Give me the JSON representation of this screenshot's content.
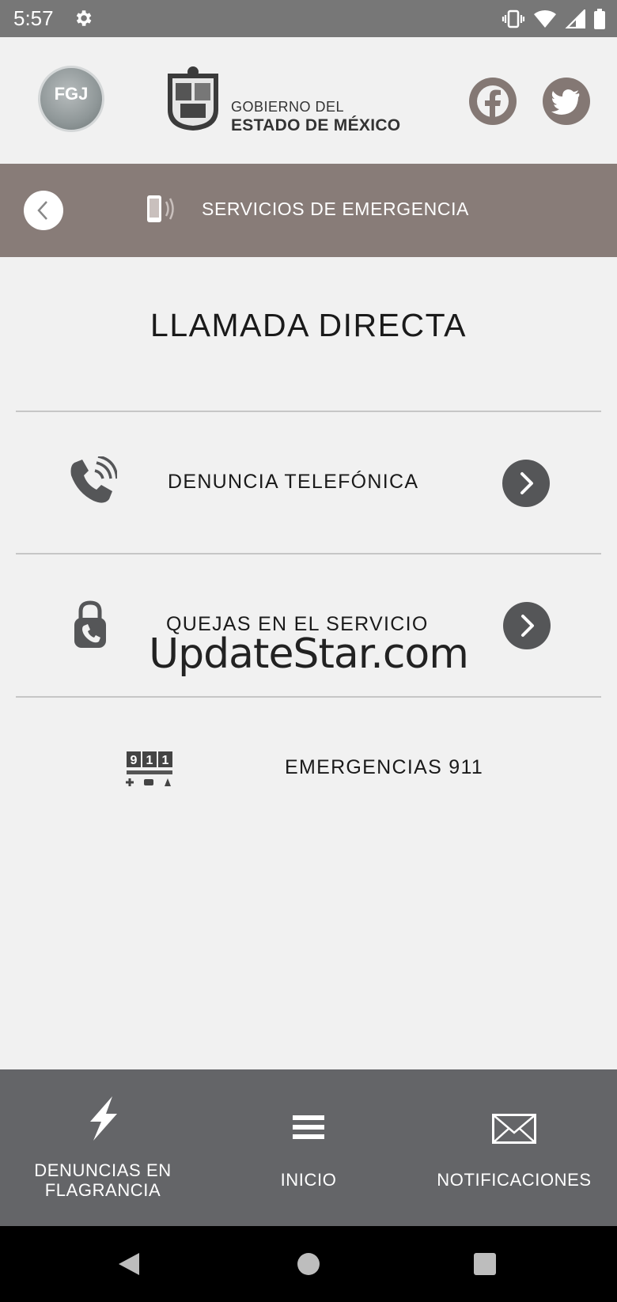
{
  "status_bar": {
    "time": "5:57",
    "icons": [
      "settings-gear-icon",
      "vibrate-icon",
      "wifi-icon",
      "signal-icon",
      "battery-icon"
    ]
  },
  "header": {
    "fgj_logo_text": "FGJ",
    "gov_line1": "GOBIERNO DEL",
    "gov_line2": "ESTADO DE MÉXICO",
    "social": [
      "facebook-icon",
      "twitter-icon"
    ]
  },
  "band": {
    "title": "SERVICIOS DE EMERGENCIA",
    "color": "#887c78"
  },
  "main": {
    "heading": "LLAMADA DIRECTA",
    "items": [
      {
        "label": "DENUNCIA TELEFÓNICA",
        "icon": "phone-call-icon"
      },
      {
        "label": "QUEJAS EN EL SERVICIO",
        "icon": "lock-phone-icon"
      },
      {
        "label": "EMERGENCIAS 911",
        "icon": "emergencias-911-icon"
      }
    ],
    "watermark": "UpdateStar.com"
  },
  "bottom_nav": {
    "tabs": [
      {
        "label_line1": "DENUNCIAS EN",
        "label_line2": "FLAGRANCIA",
        "icon": "lightning-icon"
      },
      {
        "label": "INICIO",
        "icon": "menu-icon"
      },
      {
        "label": "NOTIFICACIONES",
        "icon": "envelope-icon"
      }
    ],
    "color": "#646568"
  },
  "colors": {
    "accent_band": "#887c78",
    "bottom_bar": "#646568",
    "arrow_button": "#555658",
    "social": "#847874"
  }
}
